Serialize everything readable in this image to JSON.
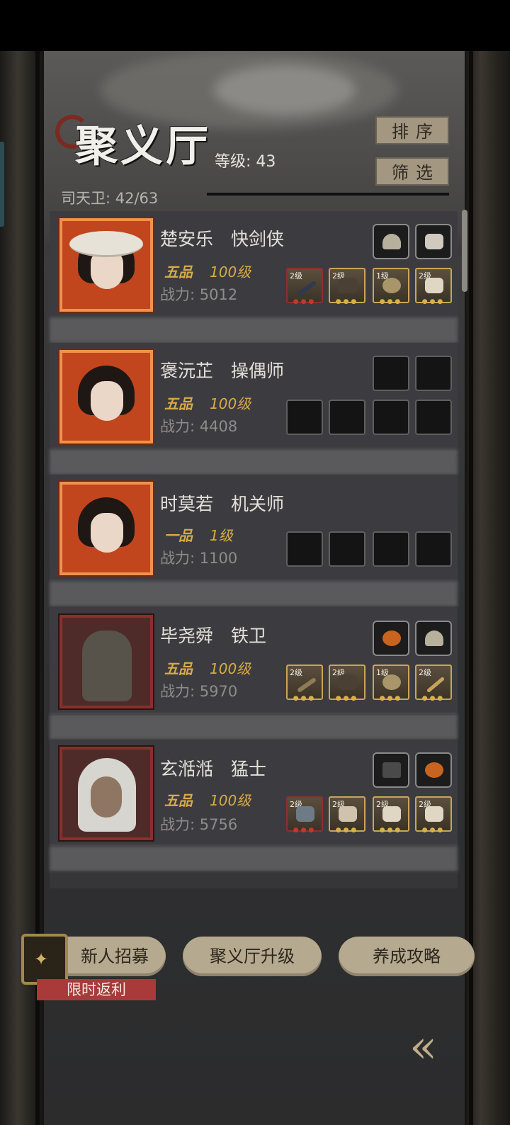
{
  "header": {
    "title": "聚义厅",
    "level_label": "等级: 43",
    "guard_count": "司天卫: 42/63",
    "sort_button": "排序",
    "filter_button": "筛选"
  },
  "heroes": [
    {
      "name": "楚安乐　快剑侠",
      "rank": "五品",
      "level": "100级",
      "power": "战力: 5012",
      "gear": [
        "2级",
        "2级",
        "1级",
        "2级"
      ],
      "frame": "orange"
    },
    {
      "name": "褒沅芷　操偶师",
      "rank": "五品",
      "level": "100级",
      "power": "战力: 4408",
      "gear": [],
      "frame": "orange"
    },
    {
      "name": "时莫若　机关师",
      "rank": "一品",
      "level": "1级",
      "power": "战力: 1100",
      "gear": [],
      "frame": "orange"
    },
    {
      "name": "毕尧舜　铁卫",
      "rank": "五品",
      "level": "100级",
      "power": "战力: 5970",
      "gear": [
        "2级",
        "2级",
        "1级",
        "2级"
      ],
      "frame": "red"
    },
    {
      "name": "玄湉湉　猛士",
      "rank": "五品",
      "level": "100级",
      "power": "战力: 5756",
      "gear": [
        "2级",
        "2级",
        "2级",
        "2级"
      ],
      "frame": "red"
    }
  ],
  "footer": {
    "recruit_button": "新人招募",
    "upgrade_button": "聚义厅升级",
    "guide_button": "养成攻略",
    "promo_label": "限时返利"
  },
  "colors": {
    "gold": "#d7ab47",
    "button": "#b5a98f",
    "promo": "#a83a3a"
  }
}
